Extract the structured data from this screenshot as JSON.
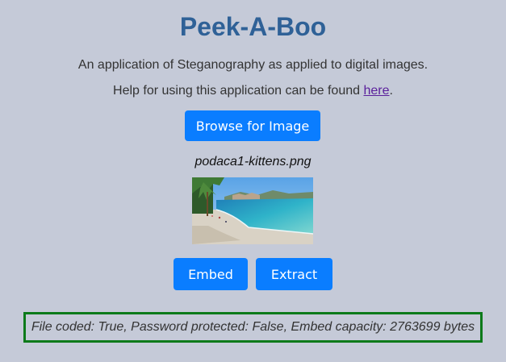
{
  "header": {
    "title": "Peek-A-Boo",
    "description": "An application of Steganography as applied to digital images.",
    "help_prefix": "Help for using this application can be found ",
    "help_link": "here",
    "help_suffix": "."
  },
  "actions": {
    "browse_label": "Browse for Image",
    "embed_label": "Embed",
    "extract_label": "Extract"
  },
  "image": {
    "filename": "podaca1-kittens.png",
    "thumbnail_icon": "beach-photo"
  },
  "status": {
    "text": "File coded: True, Password protected: False, Embed capacity: 2763699 bytes"
  },
  "colors": {
    "background": "#c5cad8",
    "title": "#2f6197",
    "button": "#0a7dff",
    "status_border": "#0c7a1a",
    "link": "#5a1f9b"
  }
}
